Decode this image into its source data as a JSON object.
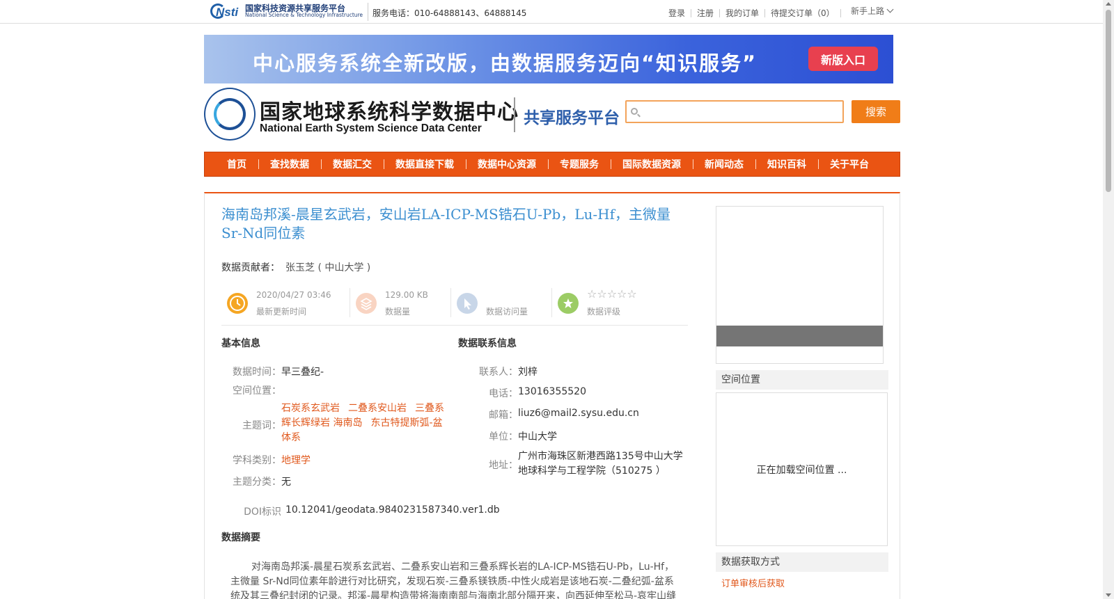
{
  "topbar": {
    "logo_cn": "国家科技资源共享服务平台",
    "logo_en": "National Science & Technology Infrastructure",
    "logo_mark": "Nsti",
    "phone": "服务电话：010-64888143、64888145",
    "links": [
      "登录",
      "注册",
      "我的订单",
      "待提交订单（0）"
    ],
    "novice": "新手上路"
  },
  "banner": {
    "text": "中心服务系统全新改版，由数据服务迈向“知识服务”",
    "button": "新版入口",
    "colors": {
      "start": "#a9c3ec",
      "end": "#2c4fd3",
      "button": "#e8404f"
    }
  },
  "site": {
    "name_cn": "国家地球系统科学数据中心",
    "name_en": "National Earth System Science Data Center",
    "platform": "共享服务平台"
  },
  "search": {
    "value": "",
    "placeholder": "",
    "button": "搜索"
  },
  "nav": [
    "首页",
    "查找数据",
    "数据汇交",
    "数据直接下载",
    "数据中心资源",
    "专题服务",
    "国际数据资源",
    "新闻动态",
    "知识百科",
    "关于平台"
  ],
  "dataset": {
    "title": "海南岛邦溪-晨星玄武岩，安山岩LA-ICP-MS锆石U-Pb，Lu-Hf，主微量 Sr-Nd同位素",
    "contributor_label": "数据贡献者：",
    "contributor": "张玉芝 ( 中山大学 )",
    "stats": {
      "updated": {
        "value": "2020/04/27 03:46",
        "label": "最新更新时间"
      },
      "size": {
        "value": "129.00 KB",
        "label": "数据量"
      },
      "visits": {
        "value": "",
        "label": "数据访问量"
      },
      "rating": {
        "stars": "☆☆☆☆☆",
        "rating_value": 0,
        "label": "数据评级"
      }
    },
    "basic": {
      "heading": "基本信息",
      "time_label": "数据时间：",
      "time_value": "早三叠纪-",
      "space_label": "空间位置：",
      "space_value": "",
      "keywords_label": "主题词：",
      "keywords": [
        "石炭系玄武岩",
        "二叠系安山岩",
        "三叠系辉长辉绿岩",
        "海南岛",
        "东古特提斯弧-盆体系"
      ],
      "subject_label": "学科类别：",
      "subject_value": "地理学",
      "category_label": "主题分类：",
      "category_value": "无",
      "doi_label": "DOI标识",
      "doi_value": "10.12041/geodata.9840231587340.ver1.db"
    },
    "contact": {
      "heading": "数据联系信息",
      "person_label": "联系人：",
      "person_value": "刘梓",
      "phone_label": "电话：",
      "phone_value": "13016355520",
      "email_label": "邮箱：",
      "email_value": "liuz6@mail2.sysu.edu.cn",
      "org_label": "单位：",
      "org_value": "中山大学",
      "addr_label": "地址：",
      "addr_value": "广州市海珠区新港西路135号中山大学地球科学与工程学院（510275 ）"
    },
    "abstract": {
      "heading": "数据摘要",
      "text": "对海南岛邦溪-晨星石炭系玄武岩、二叠系安山岩和三叠系辉长岩的LA-ICP-MS锆石U-Pb，Lu-Hf，主微量 Sr-Nd同位素年龄进行对比研究，发现石炭-三叠系镁铁质-中性火成岩是该地石炭-二叠纪弧-盆系统及其三叠纪封闭的记录。邦溪-晨星构造带将海南南部与海南北部分隔开来，向西延伸至松马-哀牢山缝合带"
    }
  },
  "sidebar": {
    "spatial_heading": "空间位置",
    "loading": "正在加载空间位置 ...",
    "access_heading": "数据获取方式",
    "access_value": "订单审核后获取"
  },
  "colors": {
    "accent": "#ea5413",
    "title": "#3c8fd0",
    "link_orange": "#e0581c",
    "search_btn": "#f07d18"
  }
}
